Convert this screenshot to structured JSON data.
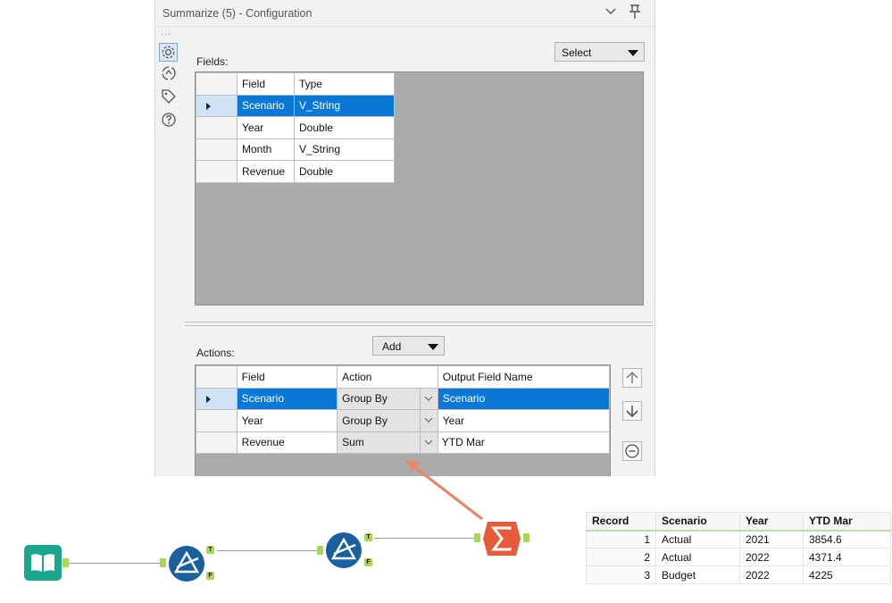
{
  "panel": {
    "title": "Summarize (5) - Configuration",
    "dots": "...",
    "fields_label": "Fields:",
    "select_button": "Select",
    "fields_table": {
      "headers": [
        "Field",
        "Type"
      ],
      "rows": [
        {
          "field": "Scenario",
          "type": "V_String",
          "selected": true
        },
        {
          "field": "Year",
          "type": "Double"
        },
        {
          "field": "Month",
          "type": "V_String"
        },
        {
          "field": "Revenue",
          "type": "Double"
        }
      ]
    },
    "actions_label": "Actions:",
    "add_button": "Add",
    "actions_table": {
      "headers": [
        "Field",
        "Action",
        "Output Field Name"
      ],
      "rows": [
        {
          "field": "Scenario",
          "action": "Group By",
          "output": "Scenario",
          "selected": true
        },
        {
          "field": "Year",
          "action": "Group By",
          "output": "Year"
        },
        {
          "field": "Revenue",
          "action": "Sum",
          "output": "YTD Mar",
          "highlight": true
        }
      ]
    },
    "side_icons": [
      "gear-icon",
      "anchor-icon",
      "tag-icon",
      "help-icon"
    ]
  },
  "workflow": {
    "tools": [
      "input-data-tool",
      "filter-tool",
      "filter-tool",
      "summarize-tool"
    ],
    "anchor_true": "T",
    "anchor_false": "F",
    "colors": {
      "input": "#1aa88c",
      "filter": "#1a5f9e",
      "summarize": "#e85b3a",
      "arrow": "#e8866a",
      "anchor": "#a8d84c"
    }
  },
  "results": {
    "headers": [
      "Record",
      "Scenario",
      "Year",
      "YTD Mar"
    ],
    "rows": [
      [
        "1",
        "Actual",
        "2021",
        "3854.6"
      ],
      [
        "2",
        "Actual",
        "2022",
        "4371.4"
      ],
      [
        "3",
        "Budget",
        "2022",
        "4225"
      ]
    ]
  }
}
